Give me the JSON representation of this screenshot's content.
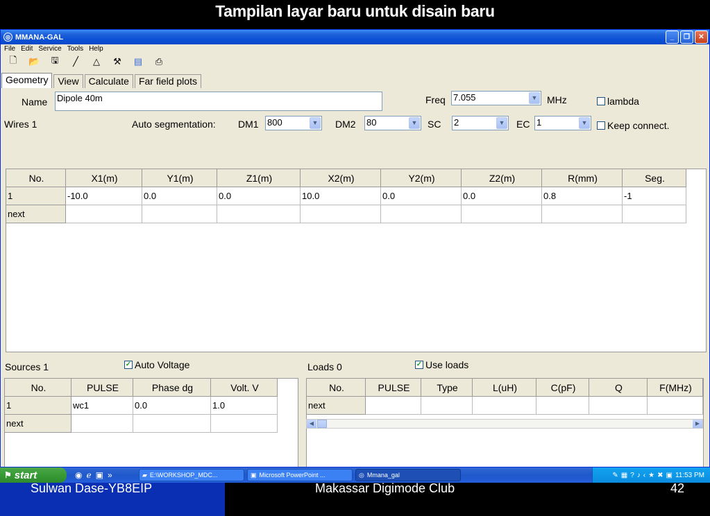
{
  "slide": {
    "title": "Tampilan layar baru untuk disain baru",
    "footer_left": "Sulwan Dase-YB8EIP",
    "footer_center": "Makassar Digimode Club",
    "footer_right": "42"
  },
  "window": {
    "title": "MMANA-GAL",
    "buttons": {
      "minimize": "_",
      "restore": "❐",
      "close": "✕"
    }
  },
  "menu": [
    "File",
    "Edit",
    "Service",
    "Tools",
    "Help"
  ],
  "toolbar_icons": [
    "new-file-icon",
    "open-folder-icon",
    "save-icon",
    "line-icon",
    "triangle-icon",
    "tools-icon",
    "notebook-icon",
    "print-icon"
  ],
  "tabs": [
    "Geometry",
    "View",
    "Calculate",
    "Far field plots"
  ],
  "geometry": {
    "name_label": "Name",
    "name_value": "Dipole 40m",
    "freq_label": "Freq",
    "freq_value": "7.055",
    "freq_unit": "MHz",
    "lambda_label": "lambda",
    "lambda_checked": false,
    "wires_label": "Wires 1",
    "autoseg_label": "Auto segmentation:",
    "dm1_label": "DM1",
    "dm1_value": "800",
    "dm2_label": "DM2",
    "dm2_value": "80",
    "sc_label": "SC",
    "sc_value": "2",
    "ec_label": "EC",
    "ec_value": "1",
    "keep_label": "Keep connect.",
    "keep_checked": false,
    "wires_columns": [
      "No.",
      "X1(m)",
      "Y1(m)",
      "Z1(m)",
      "X2(m)",
      "Y2(m)",
      "Z2(m)",
      "R(mm)",
      "Seg."
    ],
    "wires_rows": [
      [
        "1",
        "-10.0",
        "0.0",
        "0.0",
        "10.0",
        "0.0",
        "0.0",
        "0.8",
        "-1"
      ],
      [
        "next",
        "",
        "",
        "",
        "",
        "",
        "",
        "",
        ""
      ]
    ]
  },
  "sources": {
    "label": "Sources 1",
    "auto_voltage_label": "Auto Voltage",
    "auto_voltage_checked": true,
    "columns": [
      "No.",
      "PULSE",
      "Phase dg",
      "Volt. V"
    ],
    "rows": [
      [
        "1",
        "wc1",
        "0.0",
        "1.0"
      ],
      [
        "next",
        "",
        "",
        ""
      ]
    ]
  },
  "loads": {
    "label": "Loads 0",
    "use_loads_label": "Use loads",
    "use_loads_checked": true,
    "columns": [
      "No.",
      "PULSE",
      "Type",
      "L(uH)",
      "C(pF)",
      "Q",
      "F(MHz)"
    ],
    "rows": [
      [
        "next",
        "",
        "",
        "",
        "",
        "",
        ""
      ]
    ]
  },
  "taskbar": {
    "start_label": "start",
    "tasks": [
      "E:\\WORKSHOP_MDC...",
      "Microsoft PowerPoint ...",
      "Mmana_gal"
    ],
    "clock": "11:53 PM"
  }
}
